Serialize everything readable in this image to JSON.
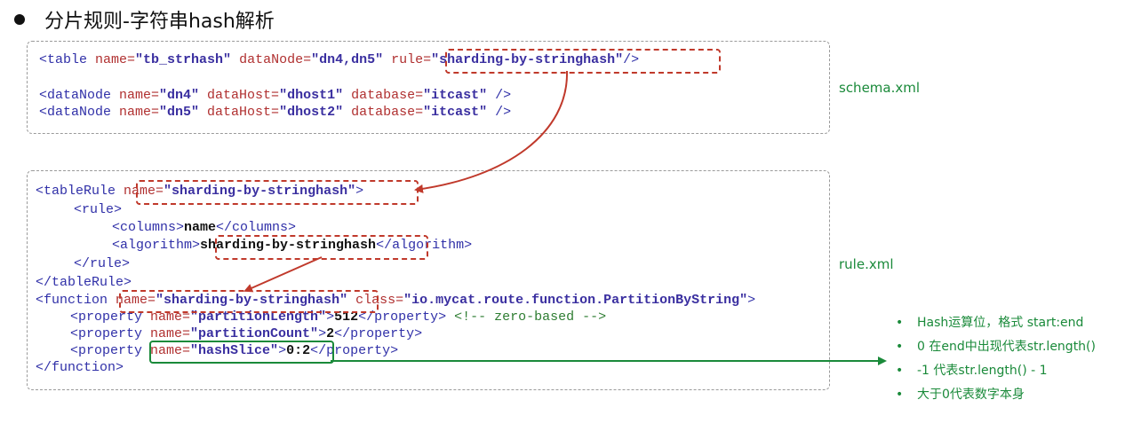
{
  "title": "分片规则-字符串hash解析",
  "files": {
    "schema": "schema.xml",
    "rule": "rule.xml"
  },
  "schema_lines": {
    "l1": {
      "a": "<table ",
      "b": "name=",
      "c": "\"tb_strhash\"",
      "d": " dataNode=",
      "e": "\"dn4,dn5\"",
      "f": " rule=",
      "g": "\"sharding-by-stringhash\"",
      "h": "/>"
    },
    "l2": {
      "a": "<dataNode ",
      "b": "name=",
      "c": "\"dn4\"",
      "d": " dataHost=",
      "e": "\"dhost1\"",
      "f": " database=",
      "g": "\"itcast\"",
      "h": " />"
    },
    "l3": {
      "a": "<dataNode ",
      "b": "name=",
      "c": "\"dn5\"",
      "d": " dataHost=",
      "e": "\"dhost2\"",
      "f": " database=",
      "g": "\"itcast\"",
      "h": " />"
    }
  },
  "rule_lines": {
    "r1": {
      "a": "<tableRule ",
      "b": "name=",
      "c": "\"sharding-by-stringhash\"",
      "d": ">"
    },
    "r2": {
      "a": "<rule>"
    },
    "r3": {
      "a": "<columns>",
      "b": "name",
      "c": "</columns>"
    },
    "r4": {
      "a": "<algorithm>",
      "b": "sharding-by-stringhash",
      "c": "</algorithm>"
    },
    "r5": {
      "a": "</rule>"
    },
    "r6": {
      "a": "</tableRule>"
    },
    "r7": {
      "a": "<function ",
      "b": "name=",
      "c": "\"sharding-by-stringhash\"",
      "d": " class=",
      "e": "\"io.mycat.route.function.PartitionByString\"",
      "f": ">"
    },
    "r8": {
      "a": "<property ",
      "b": "name=",
      "c": "\"partitionLength\"",
      "d": ">",
      "e": "512",
      "f": "</property>",
      "g": " <!-- zero-based -->"
    },
    "r9": {
      "a": "<property ",
      "b": "name=",
      "c": "\"partitionCount\"",
      "d": ">",
      "e": "2",
      "f": "</property>"
    },
    "r10": {
      "a": "<property ",
      "b": "name=",
      "c": "\"hashSlice\"",
      "d": ">",
      "e": "0:2",
      "f": "</property>"
    },
    "r11": {
      "a": "</function>"
    }
  },
  "notes": {
    "bullet": "•",
    "items": [
      "Hash运算位，格式 start:end",
      "0 在end中出现代表str.length()",
      "-1 代表str.length() - 1",
      "大于0代表数字本身"
    ]
  },
  "colors": {
    "highlight": "#c0392b",
    "accent": "#1a8a3a",
    "tag": "#3030a8",
    "attr": "#b03030",
    "value": "#3a2fa0"
  }
}
